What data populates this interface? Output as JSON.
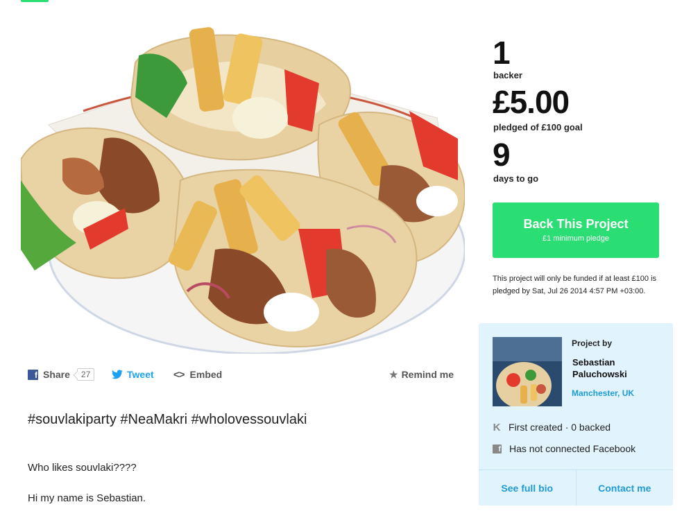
{
  "share": {
    "share_label": "Share",
    "share_count": "27",
    "tweet_label": "Tweet",
    "embed_label": "Embed",
    "remind_label": "Remind me"
  },
  "description": {
    "hashtags": "#souvlakiparty #NeaMakri #wholovessouvlaki",
    "paragraphs": [
      "Who likes souvlaki????",
      "Hi my name is Sebastian."
    ]
  },
  "stats": {
    "backers": "1",
    "backers_label": "backer",
    "pledged": "£5.00",
    "pledged_label": "pledged of £100 goal",
    "days": "9",
    "days_label": "days to go"
  },
  "back_button": {
    "label": "Back This Project",
    "sublabel": "£1 minimum pledge"
  },
  "funding_note": "This project will only be funded if at least £100 is pledged by Sat, Jul 26 2014 4:57 PM +03:00.",
  "creator": {
    "project_by": "Project by",
    "name": "Sebastian Paluchowski",
    "location": "Manchester, UK",
    "created": "First created · 0 backed",
    "facebook": "Has not connected Facebook",
    "bio_label": "See full bio",
    "contact_label": "Contact me"
  },
  "colors": {
    "accent": "#2bde73",
    "link": "#1f9bd6",
    "card_bg": "#e1f3fd"
  }
}
